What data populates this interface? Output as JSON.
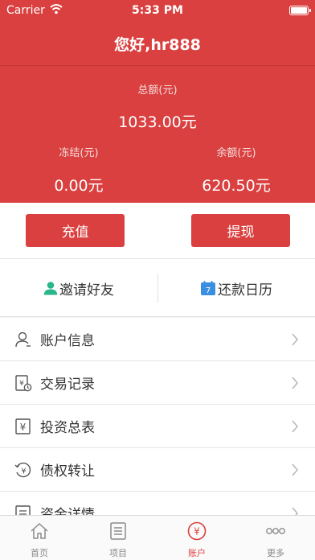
{
  "status_bar": {
    "carrier": "Carrier",
    "time": "5:33 PM"
  },
  "header": {
    "title": "您好,hr888"
  },
  "summary": {
    "total_label": "总额(元)",
    "total_value": "1033.00元",
    "frozen_label": "冻结(元)",
    "frozen_value": "0.00元",
    "balance_label": "余额(元)",
    "balance_value": "620.50元"
  },
  "actions": {
    "recharge_label": "充值",
    "withdraw_label": "提现"
  },
  "quick": {
    "invite_label": "邀请好友",
    "calendar_label": "还款日历",
    "calendar_day": "7"
  },
  "menu": {
    "items": [
      {
        "label": "账户信息",
        "icon": "user-icon"
      },
      {
        "label": "交易记录",
        "icon": "receipt-clock-icon"
      },
      {
        "label": "投资总表",
        "icon": "yen-sheet-icon"
      },
      {
        "label": "债权转让",
        "icon": "yen-transfer-icon"
      },
      {
        "label": "资金详情",
        "icon": "document-icon"
      }
    ]
  },
  "tabbar": {
    "tabs": [
      {
        "label": "首页",
        "icon": "home-icon",
        "active": false
      },
      {
        "label": "项目",
        "icon": "list-icon",
        "active": false
      },
      {
        "label": "账户",
        "icon": "yen-circle-icon",
        "active": true
      },
      {
        "label": "更多",
        "icon": "more-icon",
        "active": false
      }
    ]
  },
  "colors": {
    "brand_red": "#d9403f",
    "invite_green": "#2bb58a",
    "calendar_blue": "#3b8fe0"
  }
}
